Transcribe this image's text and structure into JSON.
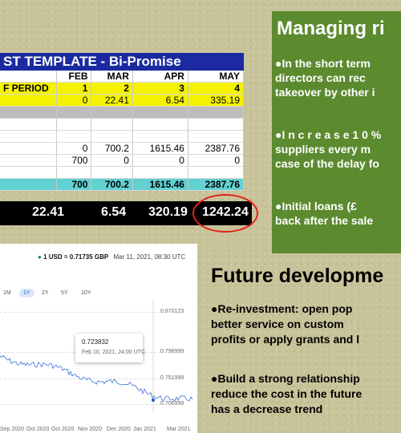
{
  "sheet": {
    "title": "ST TEMPLATE - Bi-Promise",
    "columns": [
      "FEB",
      "MAR",
      "APR",
      "MAY"
    ],
    "period_label": "F PERIOD",
    "period_values": [
      "1",
      "2",
      "3",
      "4"
    ],
    "row2": [
      "0",
      "22.41",
      "6.54",
      "335.19"
    ],
    "row_a": [
      "0",
      "700.2",
      "1615.46",
      "2387.76"
    ],
    "row_b": [
      "700",
      "0",
      "0",
      "0"
    ],
    "total": [
      "700",
      "700.2",
      "1615.46",
      "2387.76"
    ]
  },
  "black_bar": {
    "values": [
      "22.41",
      "6.54",
      "320.19",
      "1242.24"
    ]
  },
  "colors": {
    "sheet_header": "#1b2aa0",
    "highlight_yellow": "#f4f200",
    "total_teal": "#62d1d1",
    "panel_green": "#5c8a2f",
    "circle_red": "#e0231a"
  },
  "risk_panel": {
    "title": "Managing ri",
    "lines": [
      "●In the short term",
      "directors can rec",
      "takeover by other i",
      "●I n c r e a s e   1 0 %",
      "suppliers every m",
      "case of the delay fo",
      "●Initial loans (£",
      "back after the sale"
    ]
  },
  "chart": {
    "rate_label": "1 USD = ",
    "rate_value": "0.71735 GBP",
    "rate_time": "Mar 11, 2021, 08:30 UTC",
    "ranges": [
      "1M",
      "1Y",
      "2Y",
      "5Y",
      "10Y"
    ],
    "selected_range": "1Y",
    "y_ticks": [
      "0.870123",
      "0.796999",
      "0.751999",
      "0.706999"
    ],
    "x_ticks": [
      "Sep 2020",
      "Oct 2020",
      "Oct 2020",
      "Nov 2020",
      "Dec 2020",
      "Jan 2021",
      "Mar 2021"
    ],
    "tooltip_value": "0.723832",
    "tooltip_date": "Feb 10, 2021, 24:00 UTC",
    "line_color": "#4a7fd8"
  },
  "future": {
    "title": "Future developme",
    "lines": [
      "●Re-investment: open pop",
      "better service on custom",
      "profits or apply grants and l",
      "●Build a strong relationship",
      "reduce the cost in the future",
      "has a decrease trend"
    ]
  }
}
